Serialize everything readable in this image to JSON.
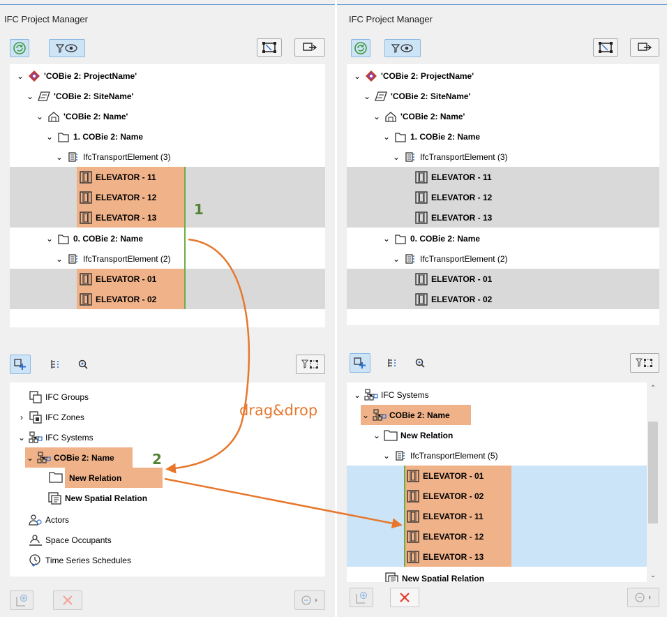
{
  "colors": {
    "highlight": "#f0b289",
    "selected_row": "#d9d9d9",
    "drop_row": "#cce4f7",
    "arrow": "#e7772c",
    "step_green": "#548235",
    "indent_line": "#70ad47"
  },
  "left": {
    "title": "IFC Project Manager",
    "tree": {
      "project": "'COBie 2: ProjectName'",
      "site": "'COBie 2: SiteName'",
      "building": "'COBie 2: Name'",
      "story1": "1. COBie 2: Name",
      "transport1": "IfcTransportElement (3)",
      "elev11": "ELEVATOR - 11",
      "elev12": "ELEVATOR - 12",
      "elev13": "ELEVATOR - 13",
      "story0": "0. COBie 2: Name",
      "transport0": "IfcTransportElement (2)",
      "elev01": "ELEVATOR - 01",
      "elev02": "ELEVATOR - 02"
    },
    "groups": {
      "ifc_groups": "IFC Groups",
      "ifc_zones": "IFC Zones",
      "ifc_systems": "IFC Systems",
      "cobie_name": "COBie 2: Name",
      "new_relation": "New Relation",
      "new_spatial_relation": "New Spatial Relation",
      "actors": "Actors",
      "space_occupants": "Space Occupants",
      "time_series": "Time Series Schedules"
    }
  },
  "right": {
    "title": "IFC Project Manager",
    "tree": {
      "project": "'COBie 2: ProjectName'",
      "site": "'COBie 2: SiteName'",
      "building": "'COBie 2: Name'",
      "story1": "1. COBie 2: Name",
      "transport1": "IfcTransportElement (3)",
      "elev11": "ELEVATOR - 11",
      "elev12": "ELEVATOR - 12",
      "elev13": "ELEVATOR - 13",
      "story0": "0. COBie 2: Name",
      "transport0": "IfcTransportElement (2)",
      "elev01": "ELEVATOR - 01",
      "elev02": "ELEVATOR - 02"
    },
    "groups": {
      "ifc_systems": "IFC Systems",
      "cobie_name": "COBie 2: Name",
      "new_relation": "New Relation",
      "transport5": "IfcTransportElement (5)",
      "elev01": "ELEVATOR - 01",
      "elev02": "ELEVATOR - 02",
      "elev11": "ELEVATOR - 11",
      "elev12": "ELEVATOR - 12",
      "elev13": "ELEVATOR - 13",
      "new_spatial_relation": "New Spatial Relation"
    }
  },
  "annotations": {
    "step1": "1",
    "step2": "2",
    "drag_drop": "drag&drop"
  }
}
